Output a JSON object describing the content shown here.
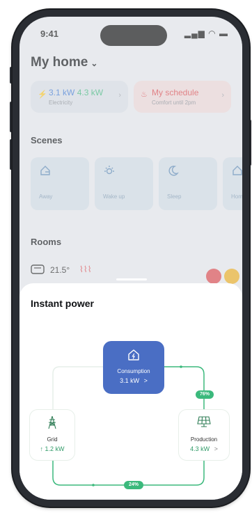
{
  "status_bar": {
    "time": "9:41"
  },
  "header": {
    "title": "My home"
  },
  "electricity_card": {
    "consumption": "3.1 kW",
    "production": "4.3 kW",
    "label": "Electricity"
  },
  "schedule_card": {
    "title": "My schedule",
    "subtitle": "Comfort until 2pm"
  },
  "scenes": {
    "heading": "Scenes",
    "items": [
      {
        "label": "Away",
        "icon": "away-icon"
      },
      {
        "label": "Wake up",
        "icon": "sun-icon"
      },
      {
        "label": "Sleep",
        "icon": "moon-icon"
      },
      {
        "label": "Hom",
        "icon": "home-icon"
      }
    ]
  },
  "rooms": {
    "heading": "Rooms",
    "first_room_temp": "21.5°"
  },
  "instant_power": {
    "title": "Instant power",
    "consumption": {
      "label": "Consumption",
      "value": "3.1 kW",
      "arrow": ">"
    },
    "grid": {
      "label": "Grid",
      "value": "↑ 1.2 kW"
    },
    "production": {
      "label": "Production",
      "value": "4.3 kW",
      "arrow": ">"
    },
    "production_to_consumption_pct": "76%",
    "production_to_grid_pct": "24%"
  },
  "colors": {
    "accent_blue": "#4a6ec4",
    "accent_green": "#3bb97c",
    "schedule_red": "#e0474c"
  }
}
